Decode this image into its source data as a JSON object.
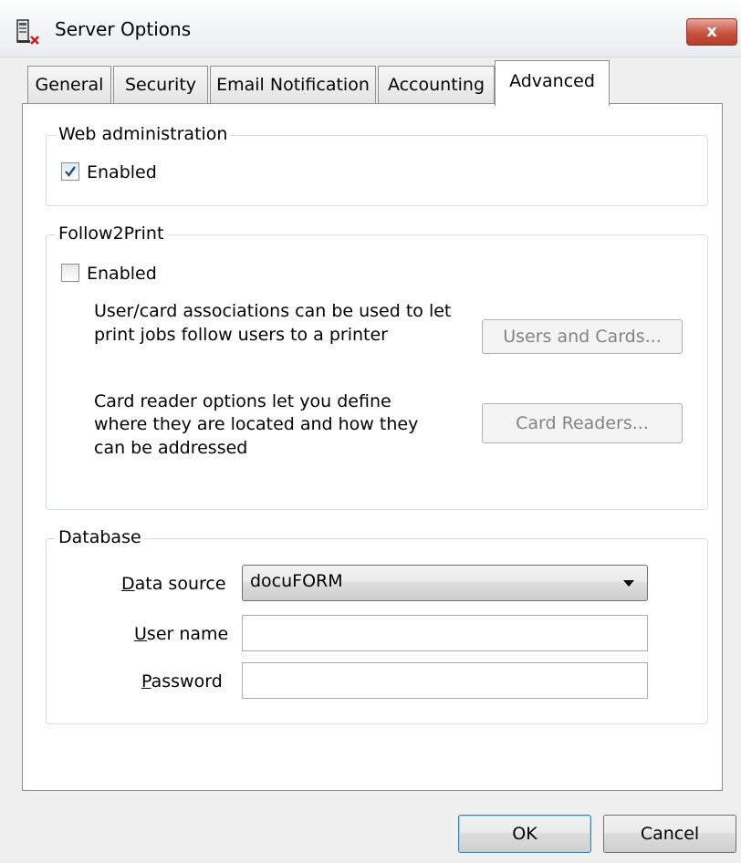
{
  "window": {
    "title": "Server Options",
    "close_label": "x"
  },
  "tabs": [
    {
      "label": "General"
    },
    {
      "label": "Security"
    },
    {
      "label": "Email Notification"
    },
    {
      "label": "Accounting"
    },
    {
      "label": "Advanced",
      "active": true
    }
  ],
  "web_admin": {
    "title": "Web administration",
    "enabled_label": "Enabled",
    "enabled": true
  },
  "follow2print": {
    "title": "Follow2Print",
    "enabled_label": "Enabled",
    "enabled": false,
    "users_text_line1": "User/card associations can be used to let",
    "users_text_line2": "print jobs follow users to a printer",
    "users_button": "Users and Cards...",
    "readers_text_line1": "Card reader options let you define",
    "readers_text_line2": "where they are located and how they",
    "readers_text_line3": "can be addressed",
    "readers_button": "Card Readers..."
  },
  "database": {
    "title": "Database",
    "data_source_label_accel": "D",
    "data_source_label_rest": "ata source",
    "data_source_value": "docuFORM",
    "user_name_label_accel": "U",
    "user_name_label_rest": "ser name",
    "user_name_value": "",
    "password_label_accel": "P",
    "password_label_rest": "assword",
    "password_value": ""
  },
  "footer": {
    "ok_label": "OK",
    "cancel_label": "Cancel"
  },
  "colors": {
    "close_button": "#c8533f",
    "checkbox_check": "#2b4b91",
    "group_border": "#d5dfe5",
    "default_button_border": "#3c7fb1"
  }
}
